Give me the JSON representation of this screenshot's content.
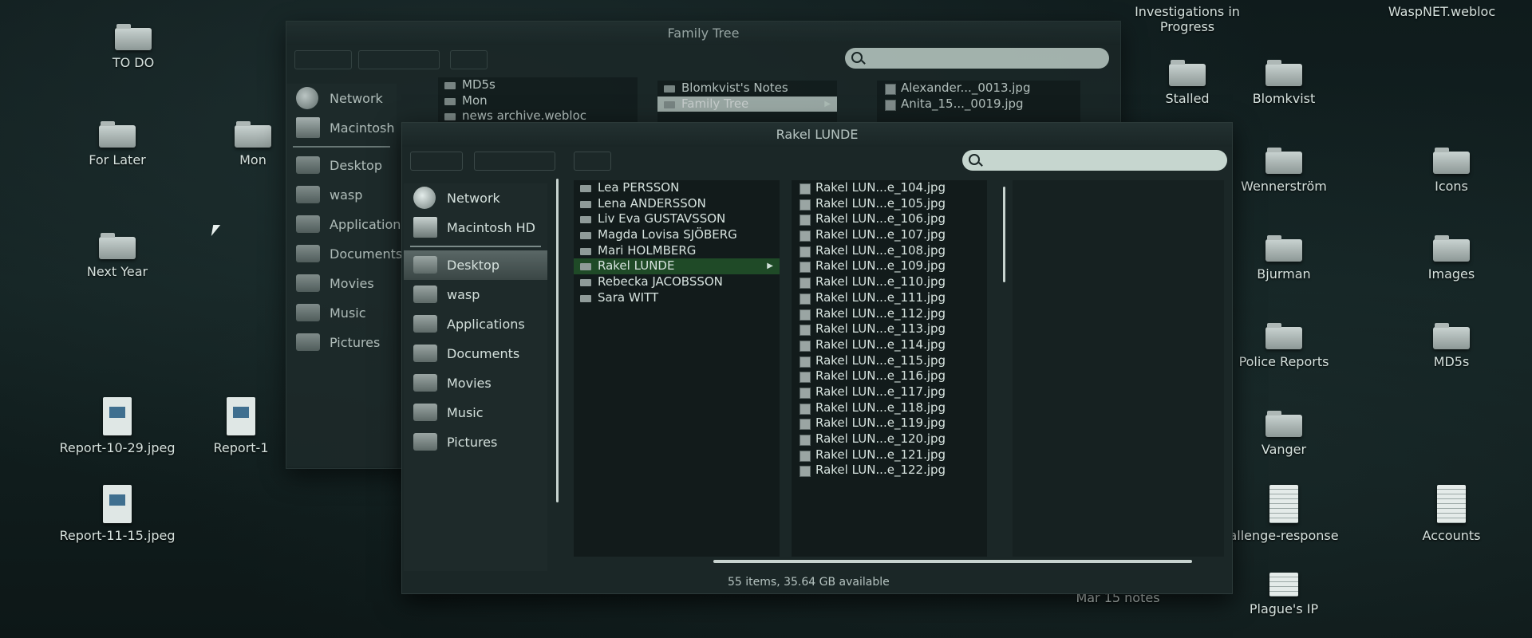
{
  "desktop_left": [
    {
      "label": "TO DO",
      "type": "folder"
    },
    {
      "label": "For Later",
      "type": "folder"
    },
    {
      "label": "Mon",
      "type": "folder"
    },
    {
      "label": "Next Year",
      "type": "folder"
    },
    {
      "label": "Report-10-29.jpeg",
      "type": "jpeg"
    },
    {
      "label": "Report-1",
      "type": "jpeg"
    },
    {
      "label": "Report-11-15.jpeg",
      "type": "jpeg"
    }
  ],
  "desktop_right": [
    {
      "label": "Investigations in Progress",
      "type": "text"
    },
    {
      "label": "WaspNET.webloc",
      "type": "text"
    },
    {
      "label": "Stalled",
      "type": "folder"
    },
    {
      "label": "Blomkvist",
      "type": "folder"
    },
    {
      "label": "Wennerström",
      "type": "folder"
    },
    {
      "label": "Icons",
      "type": "folder"
    },
    {
      "label": "Bjurman",
      "type": "folder"
    },
    {
      "label": "Images",
      "type": "folder"
    },
    {
      "label": "Police Reports",
      "type": "folder"
    },
    {
      "label": "MD5s",
      "type": "folder"
    },
    {
      "label": "Vanger",
      "type": "folder"
    },
    {
      "label": "allenge-response",
      "type": "doc"
    },
    {
      "label": "Accounts",
      "type": "doc"
    },
    {
      "label": "Mar 15 notes",
      "type": "doc"
    },
    {
      "label": "Plague's IP",
      "type": "doc"
    }
  ],
  "back_window": {
    "title": "Family Tree",
    "sidebar": [
      "Network",
      "Macintosh",
      "Desktop",
      "wasp",
      "Application",
      "Documents",
      "Movies",
      "Music",
      "Pictures"
    ],
    "col1": [
      "MD5s",
      "Mon",
      "news archive.webloc"
    ],
    "col2": [
      "Blomkvist's Notes",
      "Family Tree"
    ],
    "col3": [
      "Alexander..._0013.jpg",
      "Anita_15..._0019.jpg"
    ]
  },
  "front_window": {
    "title": "Rakel LUNDE",
    "sidebar": [
      "Network",
      "Macintosh HD",
      "Desktop",
      "wasp",
      "Applications",
      "Documents",
      "Movies",
      "Music",
      "Pictures"
    ],
    "people": [
      "Lea PERSSON",
      "Lena ANDERSSON",
      "Liv Eva GUSTAVSSON",
      "Magda Lovisa SJÖBERG",
      "Mari HOLMBERG",
      "Rakel LUNDE",
      "Rebecka JACOBSSON",
      "Sara WITT"
    ],
    "files": [
      "Rakel LUN...e_104.jpg",
      "Rakel LUN...e_105.jpg",
      "Rakel LUN...e_106.jpg",
      "Rakel LUN...e_107.jpg",
      "Rakel LUN...e_108.jpg",
      "Rakel LUN...e_109.jpg",
      "Rakel LUN...e_110.jpg",
      "Rakel LUN...e_111.jpg",
      "Rakel LUN...e_112.jpg",
      "Rakel LUN...e_113.jpg",
      "Rakel LUN...e_114.jpg",
      "Rakel LUN...e_115.jpg",
      "Rakel LUN...e_116.jpg",
      "Rakel LUN...e_117.jpg",
      "Rakel LUN...e_118.jpg",
      "Rakel LUN...e_119.jpg",
      "Rakel LUN...e_120.jpg",
      "Rakel LUN...e_121.jpg",
      "Rakel LUN...e_122.jpg"
    ],
    "status": "55 items, 35.64 GB available"
  }
}
